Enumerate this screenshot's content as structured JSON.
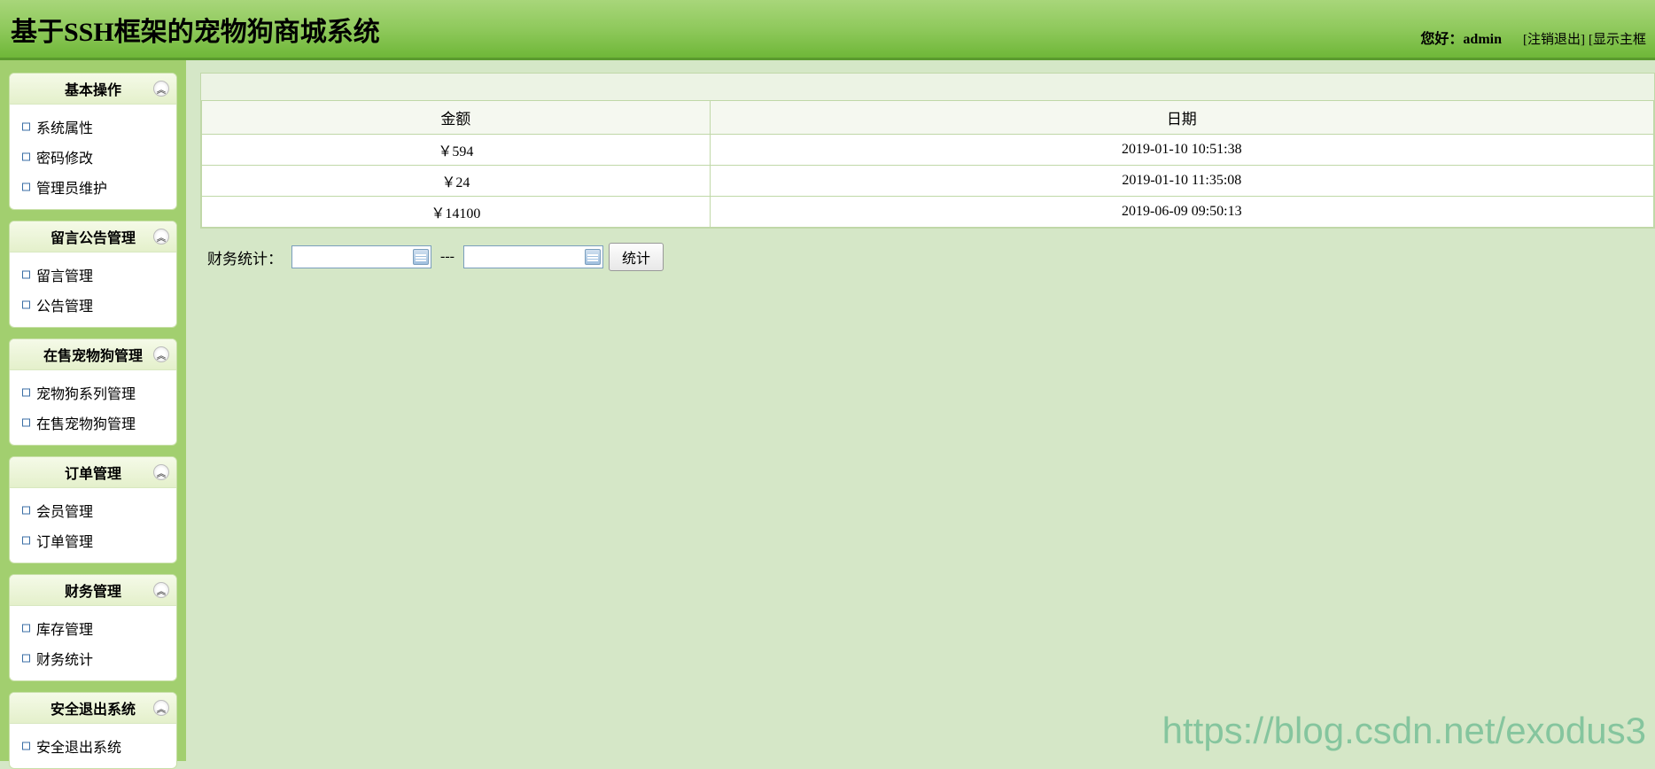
{
  "header": {
    "title": "基于SSH框架的宠物狗商城系统",
    "greeting": "您好：",
    "username": "admin",
    "logout": "[注销退出]",
    "showframe": "[显示主框"
  },
  "sidebar": {
    "panels": [
      {
        "title": "基本操作",
        "items": [
          "系统属性",
          "密码修改",
          "管理员维护"
        ]
      },
      {
        "title": "留言公告管理",
        "items": [
          "留言管理",
          "公告管理"
        ]
      },
      {
        "title": "在售宠物狗管理",
        "items": [
          "宠物狗系列管理",
          "在售宠物狗管理"
        ]
      },
      {
        "title": "订单管理",
        "items": [
          "会员管理",
          "订单管理"
        ]
      },
      {
        "title": "财务管理",
        "items": [
          "库存管理",
          "财务统计"
        ]
      },
      {
        "title": "安全退出系统",
        "items": [
          "安全退出系统"
        ]
      }
    ]
  },
  "table": {
    "headers": [
      "金额",
      "日期"
    ],
    "rows": [
      {
        "amount": "￥594",
        "date": "2019-01-10 10:51:38"
      },
      {
        "amount": "￥24",
        "date": "2019-01-10 11:35:08"
      },
      {
        "amount": "￥14100",
        "date": "2019-06-09 09:50:13"
      }
    ]
  },
  "filter": {
    "label": "财务统计：",
    "separator": "---",
    "button": "统计"
  },
  "watermark": "https://blog.csdn.net/exodus3"
}
